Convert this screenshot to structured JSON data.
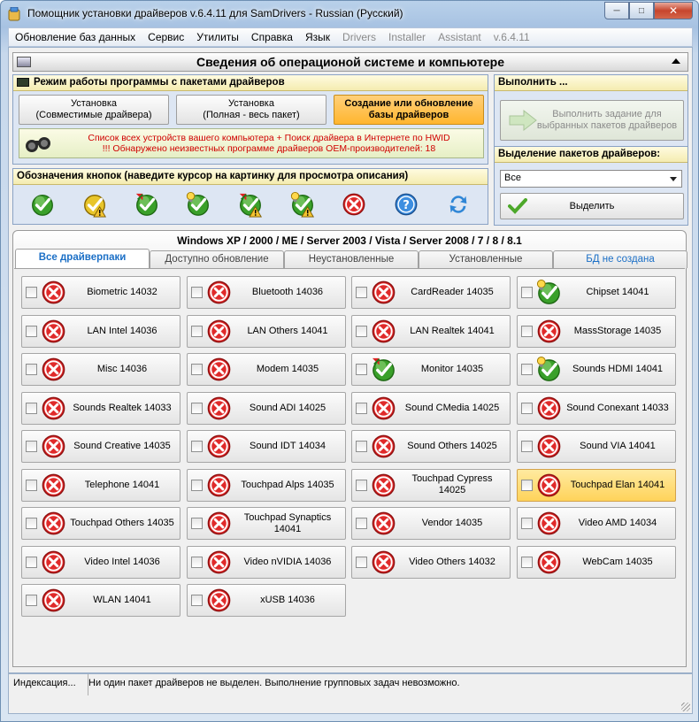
{
  "window": {
    "title": "Помощник установки драйверов v.6.4.11 для SamDrivers - Russian (Русский)"
  },
  "menu": [
    "Обновление баз данных",
    "Сервис",
    "Утилиты",
    "Справка",
    "Язык"
  ],
  "menu_disabled": [
    "Drivers",
    "Installer",
    "Assistant",
    "v.6.4.11"
  ],
  "header": {
    "title": "Сведения об операционой системе и компьютере"
  },
  "mode_panel": {
    "title": "Режим работы программы с пакетами драйверов",
    "buttons": [
      "Установка\n(Совместимые драйвера)",
      "Установка\n(Полная - весь пакет)",
      "Создание или обновление\nбазы драйверов"
    ],
    "alert_line1": "Список всех устройств вашего компьютера + Поиск драйвера в Интернете по HWID",
    "alert_line2": "!!! Обнаружено неизвестных программе драйверов OEM-производителей: 18"
  },
  "legend_panel": {
    "title": "Обозначения кнопок (наведите курсор на картинку для просмотра описания)",
    "icons": [
      "ok-icon",
      "ok-warning-icon",
      "ok-update-icon",
      "ok-bulb-icon",
      "ok-update-warning-icon",
      "ok-bulb-warning-icon",
      "error-icon",
      "help-icon",
      "refresh-icon"
    ]
  },
  "execute_panel": {
    "title": "Выполнить ...",
    "button": "Выполнить задание для\nвыбранных пакетов драйверов"
  },
  "select_panel": {
    "title": "Выделение пакетов драйверов:",
    "dropdown_value": "Все",
    "button": "Выделить"
  },
  "os_line": "Windows XP / 2000 / ME / Server 2003 / Vista / Server 2008 / 7 / 8 / 8.1",
  "tabs": [
    "Все драйверпаки",
    "Доступно обновление",
    "Неустановленные",
    "Установленные",
    "БД не создана"
  ],
  "packages": [
    {
      "label": "Biometric 14032",
      "status": "error"
    },
    {
      "label": "Bluetooth 14036",
      "status": "error"
    },
    {
      "label": "CardReader 14035",
      "status": "error"
    },
    {
      "label": "Chipset 14041",
      "status": "ok-bulb"
    },
    {
      "label": "LAN Intel 14036",
      "status": "error"
    },
    {
      "label": "LAN Others 14041",
      "status": "error"
    },
    {
      "label": "LAN Realtek 14041",
      "status": "error"
    },
    {
      "label": "MassStorage 14035",
      "status": "error"
    },
    {
      "label": "Misc 14036",
      "status": "error"
    },
    {
      "label": "Modem 14035",
      "status": "error"
    },
    {
      "label": "Monitor 14035",
      "status": "ok-update"
    },
    {
      "label": "Sounds HDMI 14041",
      "status": "ok-bulb"
    },
    {
      "label": "Sounds Realtek 14033",
      "status": "error"
    },
    {
      "label": "Sound ADI 14025",
      "status": "error"
    },
    {
      "label": "Sound CMedia 14025",
      "status": "error"
    },
    {
      "label": "Sound Conexant 14033",
      "status": "error"
    },
    {
      "label": "Sound Creative 14035",
      "status": "error"
    },
    {
      "label": "Sound IDT 14034",
      "status": "error"
    },
    {
      "label": "Sound Others 14025",
      "status": "error"
    },
    {
      "label": "Sound VIA 14041",
      "status": "error"
    },
    {
      "label": "Telephone 14041",
      "status": "error"
    },
    {
      "label": "Touchpad Alps 14035",
      "status": "error"
    },
    {
      "label": "Touchpad Cypress 14025",
      "status": "error"
    },
    {
      "label": "Touchpad Elan 14041",
      "status": "error",
      "highlighted": true
    },
    {
      "label": "Touchpad Others 14035",
      "status": "error"
    },
    {
      "label": "Touchpad Synaptics\n14041",
      "status": "error"
    },
    {
      "label": "Vendor 14035",
      "status": "error"
    },
    {
      "label": "Video AMD 14034",
      "status": "error"
    },
    {
      "label": "Video Intel 14036",
      "status": "error"
    },
    {
      "label": "Video nVIDIA 14036",
      "status": "error"
    },
    {
      "label": "Video Others 14032",
      "status": "error"
    },
    {
      "label": "WebCam 14035",
      "status": "error"
    },
    {
      "label": "WLAN 14041",
      "status": "error"
    },
    {
      "label": "xUSB 14036",
      "status": "error"
    }
  ],
  "status": {
    "left": "Индексация...",
    "message": "Ни один пакет драйверов не выделен. Выполнение групповых задач невозможно."
  },
  "colors": {
    "accent": "#ffb52e",
    "alert_text": "#d00000",
    "tab_active": "#1b6fc6"
  }
}
